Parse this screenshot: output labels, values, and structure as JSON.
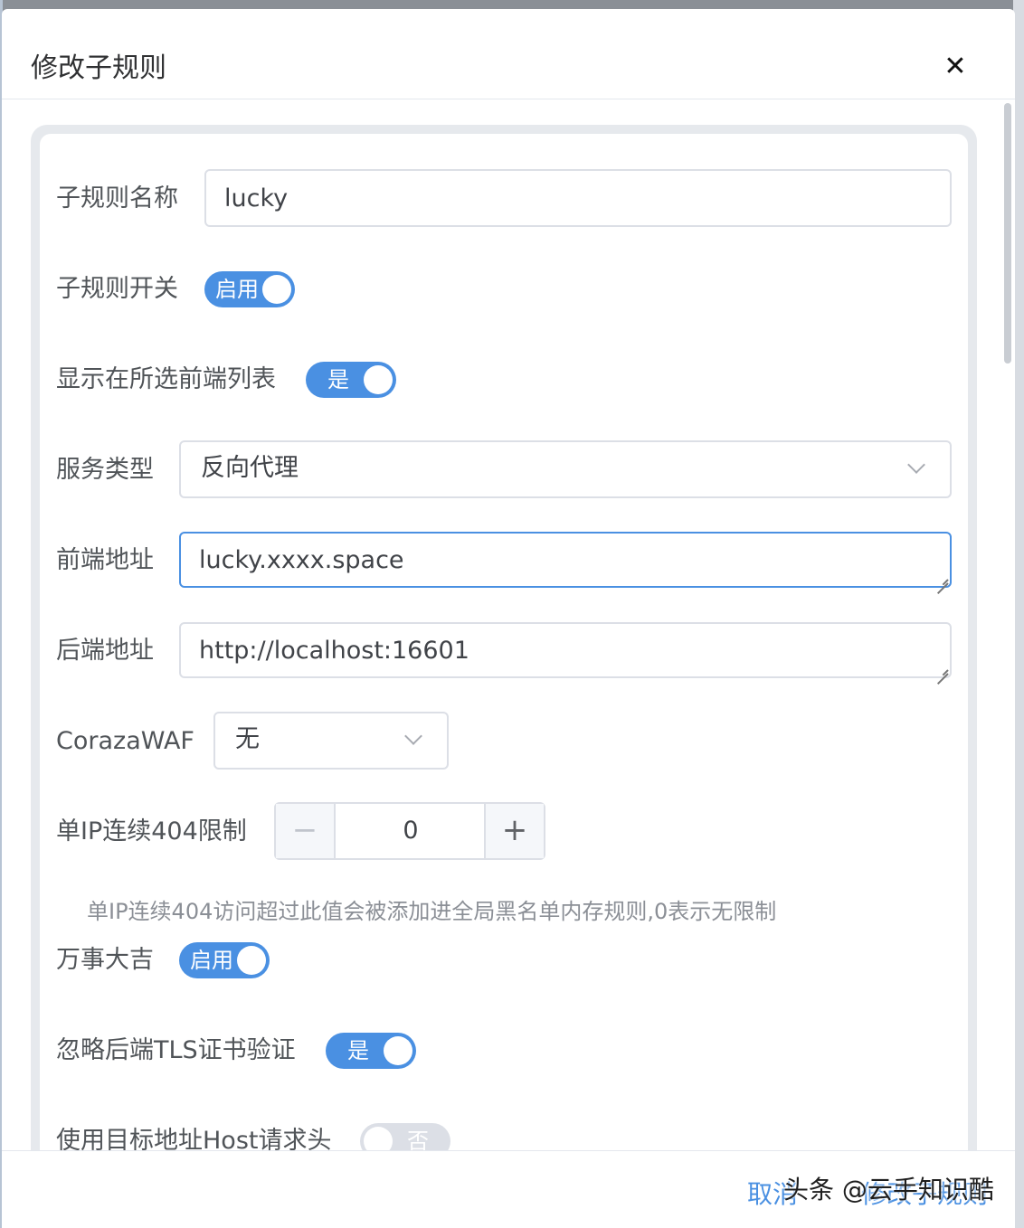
{
  "dialog": {
    "title": "修改子规则",
    "close_label": "✕"
  },
  "form": {
    "rule_name": {
      "label": "子规则名称",
      "value": "lucky"
    },
    "rule_switch": {
      "label": "子规则开关",
      "state_text": "启用",
      "on": true
    },
    "show_in_list": {
      "label": "显示在所选前端列表",
      "state_text": "是",
      "on": true
    },
    "service_type": {
      "label": "服务类型",
      "value": "反向代理"
    },
    "frontend_address": {
      "label": "前端地址",
      "value": "lucky.xxxx.space"
    },
    "backend_address": {
      "label": "后端地址",
      "value": "http://localhost:16601"
    },
    "coraza_waf": {
      "label": "CorazaWAF",
      "value": "无"
    },
    "ip_404_limit": {
      "label": "单IP连续404限制",
      "value": "0",
      "minus": "−",
      "plus": "+",
      "hint": "单IP连续404访问超过此值会被添加进全局黑名单内存规则,0表示无限制"
    },
    "wanshi_daji": {
      "label": "万事大吉",
      "state_text": "启用",
      "on": true
    },
    "ignore_tls": {
      "label": "忽略后端TLS证书验证",
      "state_text": "是",
      "on": true
    },
    "use_target_host": {
      "label": "使用目标地址Host请求头",
      "state_text": "否",
      "on": false
    }
  },
  "footer": {
    "cancel_label": "取消",
    "confirm_label": "修改子规则"
  },
  "watermark": "头条 @云手知识酷",
  "colors": {
    "accent": "#4a90e2",
    "border": "#dcdfe6",
    "switch_off": "#dcdfe6"
  }
}
